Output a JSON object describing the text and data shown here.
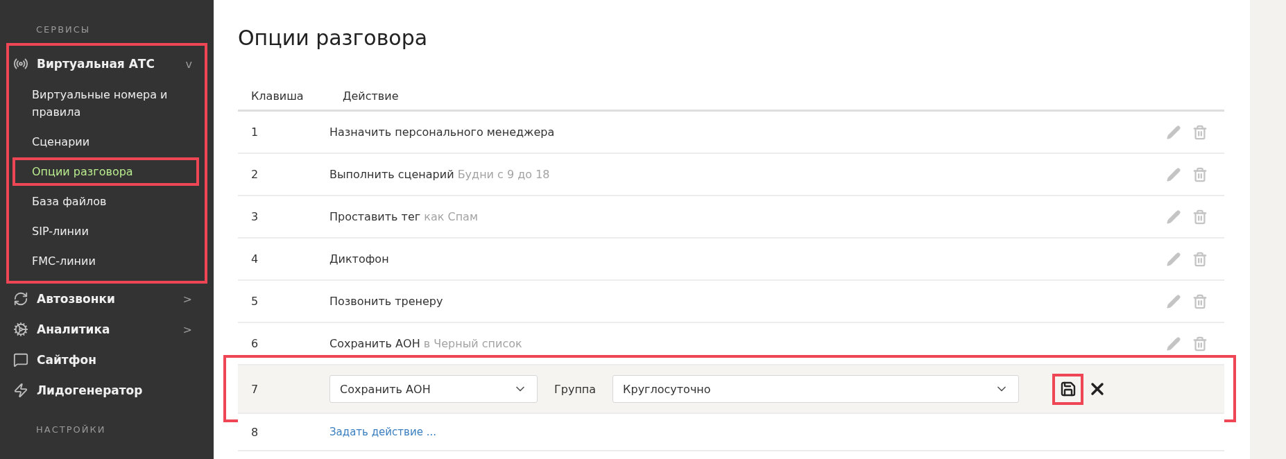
{
  "sidebar": {
    "sections": [
      {
        "heading": "СЕРВИСЫ",
        "items": [
          {
            "label": "Виртуальная АТС",
            "toggle": "v",
            "highlighted": true,
            "children": [
              {
                "label": "Виртуальные номера и правила",
                "selected": false,
                "highlighted": false
              },
              {
                "label": "Сценарии",
                "selected": false,
                "highlighted": false
              },
              {
                "label": "Опции разговора",
                "selected": true,
                "highlighted": true
              },
              {
                "label": "База файлов",
                "selected": false,
                "highlighted": false
              },
              {
                "label": "SIP-линии",
                "selected": false,
                "highlighted": false
              },
              {
                "label": "FMC-линии",
                "selected": false,
                "highlighted": false
              }
            ]
          },
          {
            "label": "Автозвонки",
            "toggle": ">",
            "highlighted": false
          },
          {
            "label": "Аналитика",
            "toggle": ">",
            "highlighted": false
          },
          {
            "label": "Сайтфон",
            "highlighted": false
          },
          {
            "label": "Лидогенератор",
            "highlighted": false
          }
        ]
      },
      {
        "heading": "НАСТРОЙКИ"
      }
    ]
  },
  "page": {
    "title": "Опции разговора"
  },
  "table": {
    "columns": [
      "Клавиша",
      "Действие"
    ],
    "rows": [
      {
        "kind": "view",
        "key": "1",
        "action": "Назначить персонального менеджера"
      },
      {
        "kind": "view",
        "key": "2",
        "action": "Выполнить сценарий",
        "detail": "Будни с 9 до 18"
      },
      {
        "kind": "view",
        "key": "3",
        "action": "Проставить тег",
        "detail": "как Спам"
      },
      {
        "kind": "view",
        "key": "4",
        "action": "Диктофон"
      },
      {
        "kind": "view",
        "key": "5",
        "action": "Позвонить тренеру"
      },
      {
        "kind": "view",
        "key": "6",
        "action": "Сохранить АОН",
        "detail": "в Черный список"
      },
      {
        "kind": "edit",
        "key": "7",
        "select": "Сохранить АОН",
        "group_label": "Группа",
        "group_select": "Круглосуточно",
        "save_highlighted": true,
        "highlighted": true
      },
      {
        "kind": "empty",
        "key": "8",
        "link": "Задать действие ..."
      }
    ]
  }
}
